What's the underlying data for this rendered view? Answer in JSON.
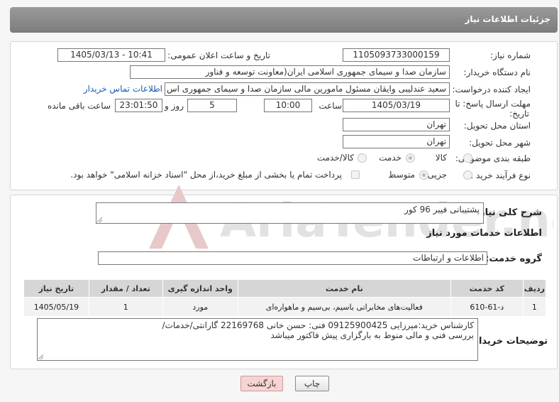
{
  "header": {
    "title": "جزئیات اطلاعات نیاز"
  },
  "form": {
    "need_number_label": "شماره نیاز:",
    "need_number": "1105093733000159",
    "announce_label": "تاریخ و ساعت اعلان عمومی:",
    "announce_value": "1405/03/13 - 10:41",
    "buyer_org_label": "نام دستگاه خریدار:",
    "buyer_org": "سازمان صدا و سیمای جمهوری اسلامی ایران(معاونت توسعه و فناور",
    "requester_label": "ایجاد کننده درخواست:",
    "requester": "سعید عندلیبی وایقان مسئول مامورین مالی  سازمان صدا و سیمای جمهوری اس",
    "contact_link": "اطلاعات تماس خریدار",
    "deadline_label_1": "مهلت ارسال پاسخ: تا",
    "deadline_label_2": "تاریخ:",
    "deadline_date": "1405/03/19",
    "time_label": "ساعت",
    "deadline_time": "10:00",
    "days_value": "5",
    "days_label": "روز و",
    "remaining_time": "23:01:50",
    "remaining_label": "ساعت باقی مانده",
    "province_label": "استان محل تحویل:",
    "province": "تهران",
    "city_label": "شهر محل تحویل:",
    "city": "تهران",
    "category_label": "طبقه بندی موضوعی:",
    "category_options": [
      "کالا",
      "خدمت",
      "کالا/خدمت"
    ],
    "process_label": "نوع فرآیند خرید :",
    "process_options": [
      "جزیی",
      "متوسط"
    ],
    "payment_note": "پرداخت تمام یا بخشی از مبلغ خرید،از محل \"اسناد خزانه اسلامی\" خواهد بود."
  },
  "summary": {
    "label": "شرح کلی نیاز:",
    "value": "پشتیبانی فیبر 96 کور"
  },
  "services": {
    "section_title": "اطلاعات خدمات مورد نیاز",
    "group_label": "گروه خدمت:",
    "group_value": "اطلاعات و ارتباطات",
    "columns": [
      "ردیف",
      "کد خدمت",
      "نام خدمت",
      "واحد اندازه گیری",
      "تعداد / مقدار",
      "تاریخ نیاز"
    ],
    "rows": [
      [
        "1",
        "د-61-610",
        "فعالیت‌های مخابراتی باسیم، بی‌سیم و ماهواره‌ای",
        "مورد",
        "1",
        "1405/05/19"
      ]
    ]
  },
  "notes": {
    "label": "توضیحات خریدار:",
    "line1": "کارشناس خرید:میرزایی 09125900425  فنی: حسن خانی  22169768  گارانتی/خدمات/",
    "line2": "بررسی فنی و مالی منوط به بارگزاری پیش فاکتور میباشد"
  },
  "buttons": {
    "print": "چاپ",
    "back": "بازگشت"
  },
  "watermark": {
    "text": "AriaTender.neT"
  }
}
